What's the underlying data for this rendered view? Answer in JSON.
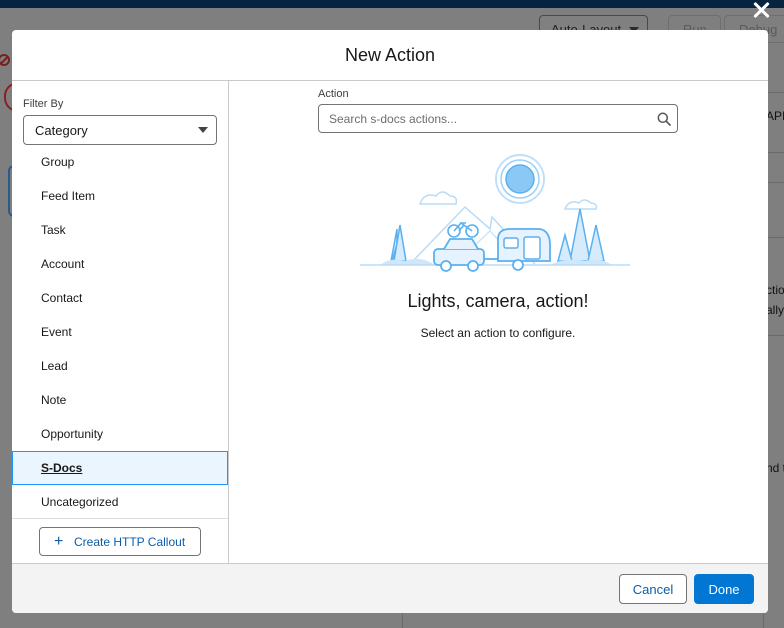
{
  "background": {
    "layout_select": "Auto-Layout",
    "run_label": "Run",
    "debug_label": "Debug",
    "right_snippets": [
      "API",
      "ctio",
      "ally",
      "nd t"
    ]
  },
  "modal": {
    "title": "New Action",
    "filter": {
      "label": "Filter By",
      "selected": "Category"
    },
    "categories": [
      {
        "label": "Group"
      },
      {
        "label": "Feed Item"
      },
      {
        "label": "Task"
      },
      {
        "label": "Account"
      },
      {
        "label": "Contact"
      },
      {
        "label": "Event"
      },
      {
        "label": "Lead"
      },
      {
        "label": "Note"
      },
      {
        "label": "Opportunity"
      },
      {
        "label": "S-Docs",
        "selected": true
      },
      {
        "label": "Uncategorized"
      }
    ],
    "create_http_callout_label": "Create HTTP Callout",
    "action": {
      "label": "Action",
      "placeholder": "Search s-docs actions...",
      "value": ""
    },
    "empty_state": {
      "title": "Lights, camera, action!",
      "subtitle": "Select an action to configure."
    },
    "footer": {
      "cancel_label": "Cancel",
      "done_label": "Done"
    }
  },
  "colors": {
    "brand": "#0176d3",
    "link": "#0b5cab",
    "selected_bg": "#eaf5fe",
    "selected_border": "#1b96ff",
    "illustration": "#5ab0f0"
  }
}
